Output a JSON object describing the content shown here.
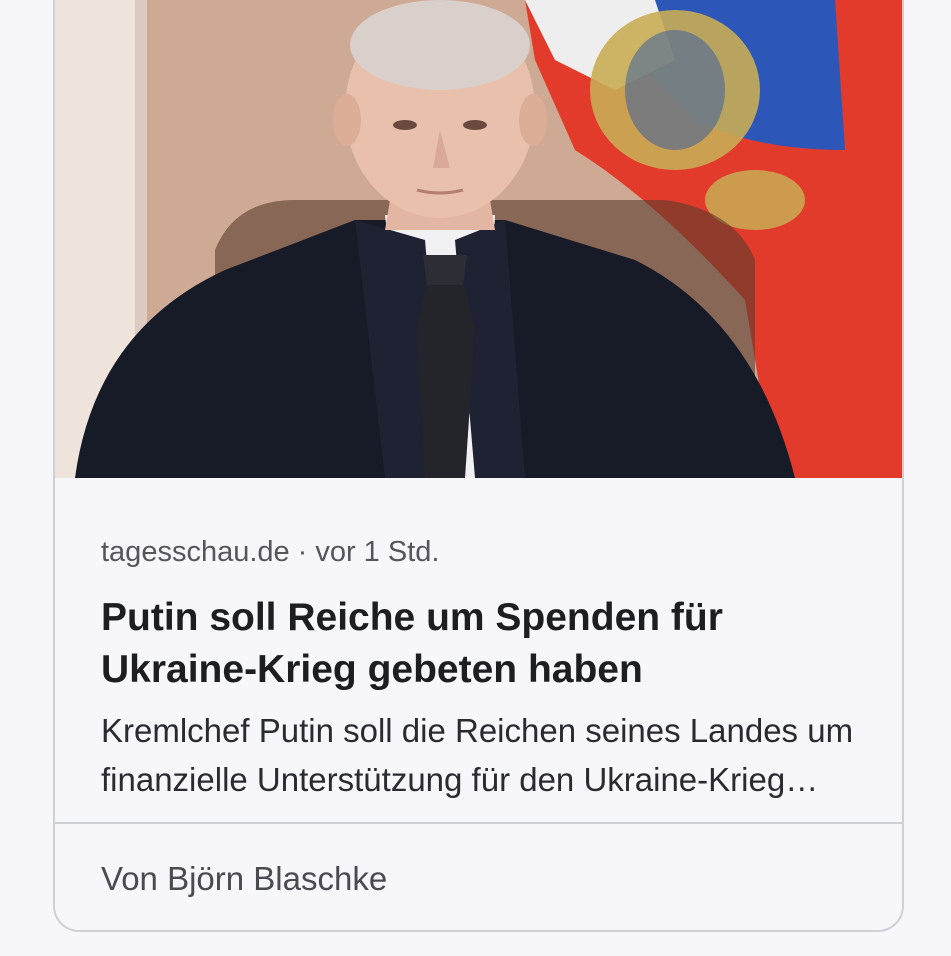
{
  "article": {
    "image_alt": "Porträt Wladimir Putin vor russischer Flagge",
    "source": "tagesschau.de",
    "separator": "·",
    "time": "vor 1 Std.",
    "headline": "Putin soll Reiche um Spenden für Ukraine-Krieg gebeten haben",
    "snippet": "Kremlchef Putin soll die Reichen seines Landes um finanzielle Unterstützung für den Ukraine-Krieg gebeten haben.",
    "author": "Von Björn Blaschke"
  },
  "colors": {
    "background": "#f6f6fb",
    "border": "#cfcfd6",
    "headline": "#1d1e22",
    "meta": "#55565c"
  }
}
